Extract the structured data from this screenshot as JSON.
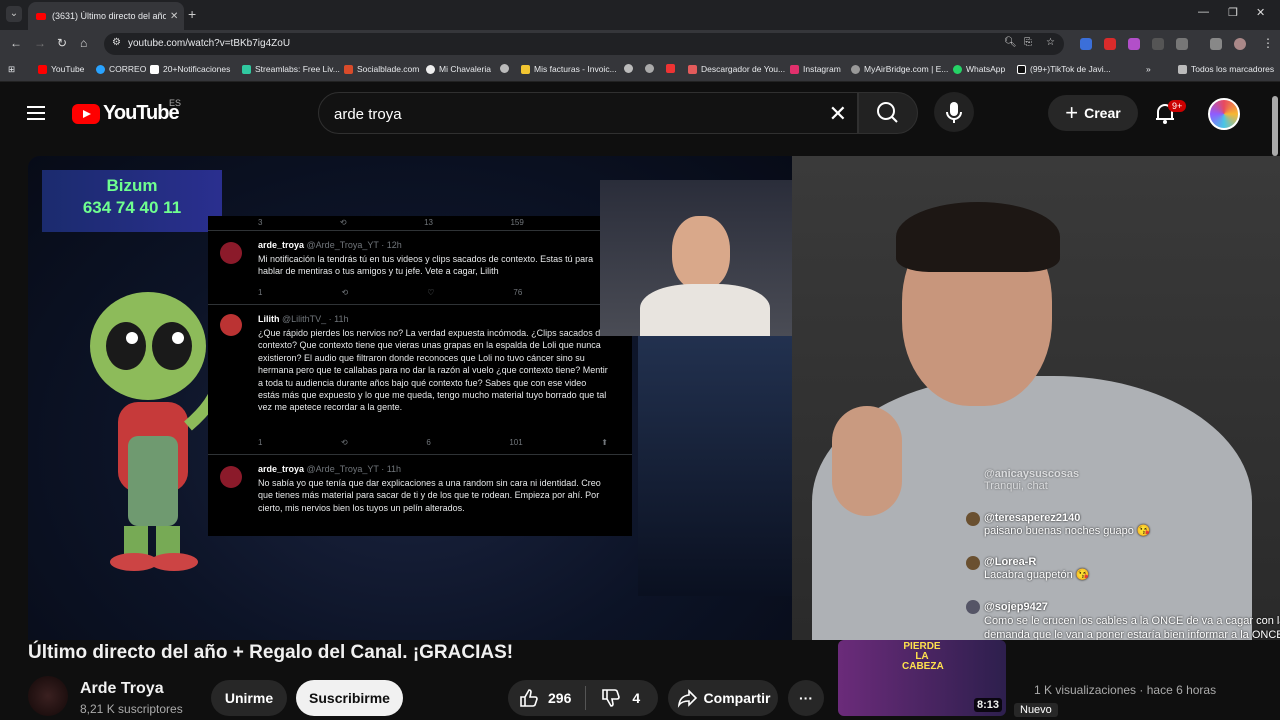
{
  "browser": {
    "tab_title": "(3631) Último directo del año -",
    "url": "youtube.com/watch?v=tBKb7ig4ZoU",
    "bookmarks": [
      "YouTube",
      "CORREO",
      "20+Notificaciones",
      "Streamlabs: Free Liv...",
      "Socialblade.com",
      "Mi Chavaleria",
      "Mis facturas - Invoic...",
      "Descargador de You...",
      "Instagram",
      "MyAirBridge.com | E...",
      "WhatsApp",
      "(99+)TikTok de Javi..."
    ],
    "all_bookmarks": "Todos los marcadores"
  },
  "header": {
    "logo_text": "YouTube",
    "region": "ES",
    "search_query": "arde troya",
    "create_label": "Crear",
    "notif_badge": "9+"
  },
  "player": {
    "bizum_label": "Bizum",
    "bizum_number": "634 74 40 11",
    "tweets": [
      {
        "user": "arde_troya",
        "handle": "@Arde_Troya_YT · 12h",
        "text": "Mi notificación la tendrás tú en tus videos y clips sacados de contexto. Estas tú para hablar de mentiras o tus amigos y tu jefe. Vete a cagar, Lilith",
        "reply": "1",
        "like": "",
        "views": "76"
      },
      {
        "user": "Lilith",
        "handle": "@LilithTV_ · 11h",
        "text": "¿Que rápido pierdes los nervios no? La verdad expuesta incómoda. ¿Clips sacados de contexto? Que contexto tiene que vieras unas grapas en la espalda de Loli que nunca existieron? El audio que filtraron donde reconoces que Loli no tuvo cáncer sino su hermana pero que te callabas para no dar la razón al vuelo ¿que contexto tiene? Mentir a toda tu audiencia durante años bajo qué contexto fue? Sabes que con ese video estás más que expuesto y lo que me queda, tengo mucho material tuyo borrado que tal vez me apetece recordar a la gente.",
        "reply": "1",
        "like": "6",
        "views": "101"
      },
      {
        "user": "arde_troya",
        "handle": "@Arde_Troya_YT · 11h",
        "text": "No sabía yo que tenía que dar explicaciones a una random sin cara ni identidad. Creo que tienes más material para sacar de ti y de los que te rodean. Empieza por ahí. Por cierto, mis nervios bien los tuyos un pelín alterados.",
        "reply": "",
        "like": "",
        "views": ""
      }
    ],
    "tweet_top_counts": [
      "3",
      "13",
      "159"
    ]
  },
  "chat": [
    {
      "user": "@anicaysuscosas",
      "text": "Tranqui, chat"
    },
    {
      "user": "@teresaperez2140",
      "text": "paisano buenas noches guapo 😘"
    },
    {
      "user": "@Lorea-R",
      "text": "Lacabra guapetón 😘"
    },
    {
      "user": "@sojep9427",
      "text": "Como se le crucen los cables a la ONCE de va a cagar con la demanda que le van a poner estaría bien informar a la ONCE de lo que está haciendo , al trolitas este se le va a caer el pelo 🤣🤣🤣"
    }
  ],
  "video": {
    "title": "Último directo del año + Regalo del Canal. ¡GRACIAS!",
    "channel": "Arde Troya",
    "subscribers": "8,21 K suscriptores",
    "join_label": "Unirme",
    "subscribe_label": "Suscribirme",
    "likes": "296",
    "dislikes": "4",
    "share_label": "Compartir"
  },
  "upnext": {
    "thumb_text": "PIERDE LA CABEZA",
    "duration": "8:13",
    "meta": "1 K visualizaciones · hace 6 horas",
    "new_label": "Nuevo"
  }
}
